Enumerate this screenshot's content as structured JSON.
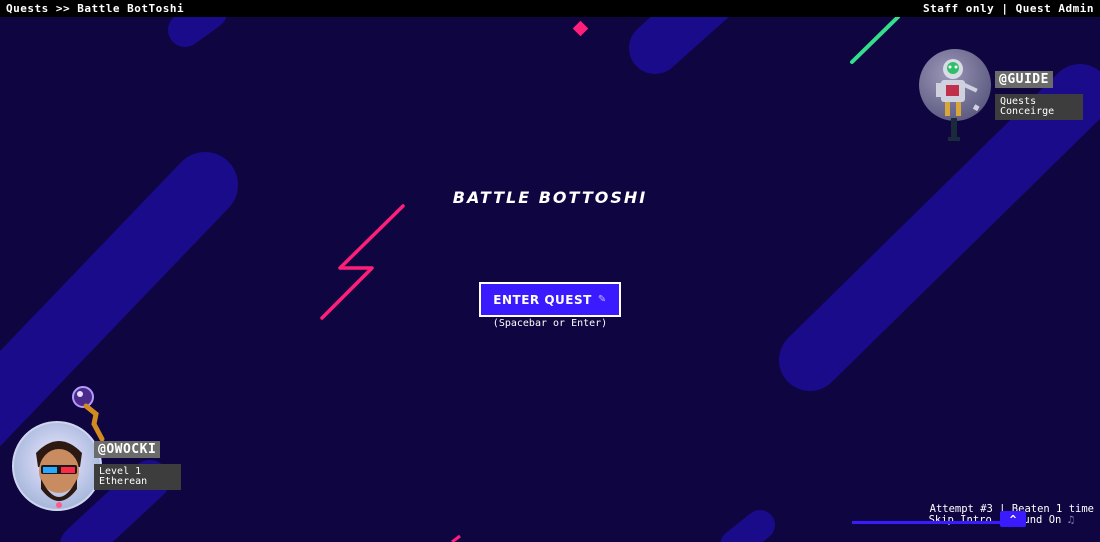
{
  "topbar": {
    "breadcrumb": "Quests >> Battle BotToshi",
    "staff_only": "Staff only",
    "separator": "|",
    "quest_admin": "Quest Admin"
  },
  "main": {
    "title": "BATTLE BOTTOSHI",
    "enter_button": "ENTER QUEST",
    "enter_hint": "(Spacebar or Enter)"
  },
  "guide": {
    "handle": "@GUIDE",
    "role_line1": "Quests",
    "role_line2": "Conceirge"
  },
  "player": {
    "handle": "@OWOCKI",
    "level": "Level 1",
    "rank": "Etherean"
  },
  "footer": {
    "attempt_line": "Attempt #3 | Beaten 1 time",
    "skip_intro": "Skip Intro",
    "separator": "|",
    "sound_on": "Sound On",
    "scroll_top": "^"
  },
  "colors": {
    "background": "#0f0540",
    "stripe": "#1a0b8a",
    "accent_button": "#3a1aff",
    "neon_pink": "#ff1f7a",
    "neon_green": "#33e08a"
  },
  "icons": {
    "pencil": "pencil-icon",
    "music": "music-note-icon"
  }
}
